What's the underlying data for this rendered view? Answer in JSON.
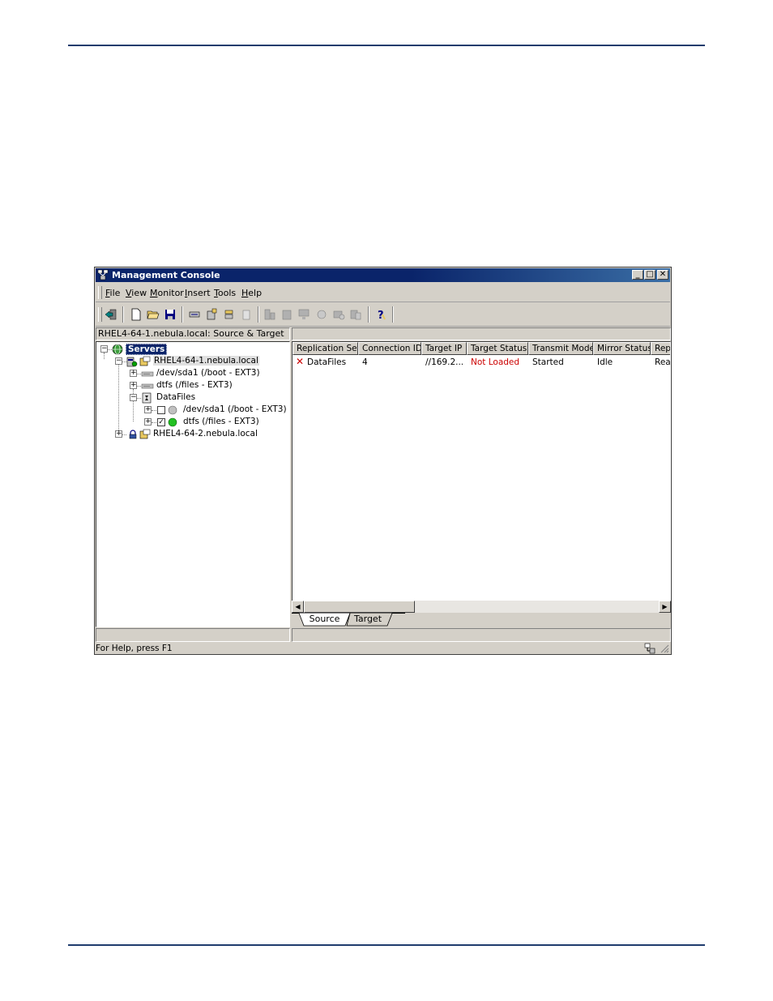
{
  "window": {
    "title": "Management Console"
  },
  "menu": [
    "File",
    "View",
    "Monitor",
    "Insert",
    "Tools",
    "Help"
  ],
  "left_header": "RHEL4-64-1.nebula.local: Source & Target",
  "tree": {
    "root": "Servers",
    "server1": "RHEL4-64-1.nebula.local",
    "vol1": "/dev/sda1 (/boot - EXT3)",
    "vol2": "dtfs (/files - EXT3)",
    "set": "DataFiles",
    "set_vol1": "/dev/sda1 (/boot - EXT3)",
    "set_vol2": "dtfs (/files - EXT3)",
    "server2": "RHEL4-64-2.nebula.local"
  },
  "columns": [
    "Replication Set",
    "Connection ID",
    "Target IP",
    "Target Status",
    "Transmit Mode",
    "Mirror Status",
    "Rep"
  ],
  "row": {
    "replication_set": "DataFiles",
    "connection_id": "4",
    "target_ip": "//169.2...",
    "target_status": "Not Loaded",
    "transmit_mode": "Started",
    "mirror_status": "Idle",
    "rep": "Rea"
  },
  "tabs": [
    "Source",
    "Target"
  ],
  "status": "For Help, press F1",
  "colors": {
    "title_bar": "#0a246a",
    "rule": "#1f3c6e",
    "error": "#cc0000",
    "selection": "#0a246a"
  }
}
